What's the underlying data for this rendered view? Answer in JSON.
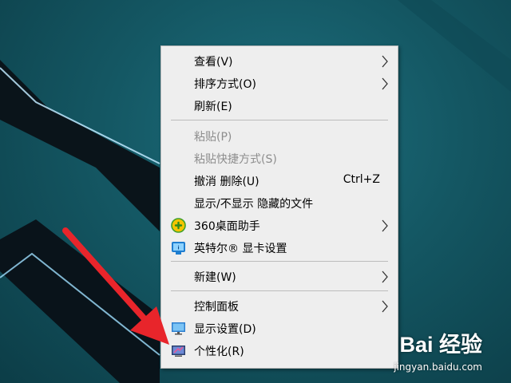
{
  "menu": {
    "items": [
      {
        "label": "查看(V)",
        "has_submenu": true
      },
      {
        "label": "排序方式(O)",
        "has_submenu": true
      },
      {
        "label": "刷新(E)"
      },
      {
        "label": "粘贴(P)",
        "disabled": true
      },
      {
        "label": "粘贴快捷方式(S)",
        "disabled": true
      },
      {
        "label": "撤消 删除(U)",
        "shortcut": "Ctrl+Z"
      },
      {
        "label": "显示/不显示 隐藏的文件"
      },
      {
        "label": "360桌面助手",
        "icon": "360-assistant-icon",
        "has_submenu": true
      },
      {
        "label": "英特尔® 显卡设置",
        "icon": "intel-graphics-icon"
      },
      {
        "label": "新建(W)",
        "has_submenu": true
      },
      {
        "label": "控制面板",
        "has_submenu": true
      },
      {
        "label": "显示设置(D)",
        "icon": "display-settings-icon"
      },
      {
        "label": "个性化(R)",
        "icon": "personalize-icon"
      }
    ]
  },
  "watermark": {
    "brand": "Bai 经验",
    "url": "jingyan.baidu.com"
  },
  "colors": {
    "desktop": "#145763",
    "menu_bg": "#eeeeee",
    "disabled_text": "#8d8d8d",
    "arrow": "#e8252b"
  }
}
